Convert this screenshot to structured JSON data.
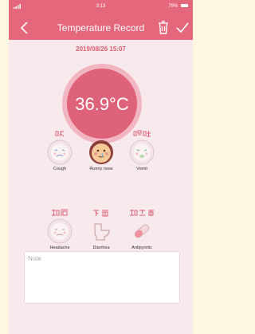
{
  "status_bar": {
    "time": "3:13",
    "battery": "79%"
  },
  "header": {
    "title": "Temperature Record"
  },
  "record": {
    "datetime": "2019/08/26 15:07",
    "temperature": "36.9°C"
  },
  "symptoms": [
    {
      "label": "Cough",
      "selected": false
    },
    {
      "label": "Runny nose",
      "selected": true
    },
    {
      "label": "Vomit",
      "selected": false
    },
    {
      "label": "Headache",
      "selected": false
    },
    {
      "label": "Diarrhea",
      "selected": false
    },
    {
      "label": "Antipyretic",
      "selected": false
    }
  ],
  "note": {
    "placeholder": "Note"
  },
  "colors": {
    "accent": "#e5677c",
    "background": "#f8e9ec",
    "selected_face": "#8b3d3a"
  }
}
